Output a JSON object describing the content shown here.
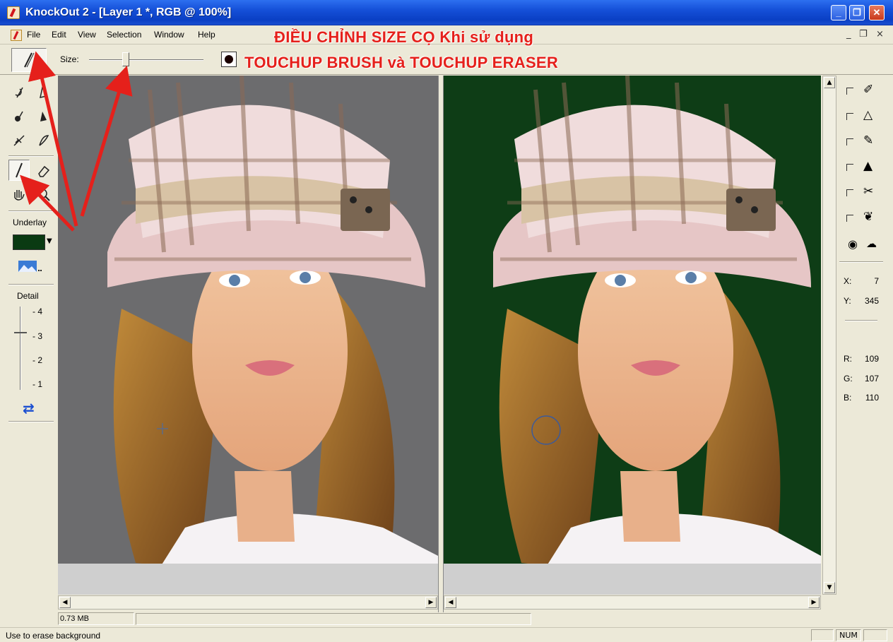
{
  "window": {
    "title": "KnockOut 2 - [Layer 1 *, RGB @ 100%]",
    "controls": {
      "minimize": "_",
      "restore": "❐",
      "close": "✕"
    }
  },
  "menu": {
    "items": [
      "File",
      "Edit",
      "View",
      "Selection",
      "Window",
      "Help"
    ],
    "mdi_controls": {
      "minimize": "_",
      "restore": "❐",
      "close": "×"
    }
  },
  "annotation": {
    "line1": "ĐIỀU CHỈNH SIZE CỌ Khi sử dụng",
    "line2": "TOUCHUP BRUSH và TOUCHUP ERASER",
    "color": "#e5201b"
  },
  "tool_options": {
    "size_label": "Size:",
    "size_value_fraction": 0.32,
    "current_tool_icon": "touchup-brush-icon"
  },
  "left_toolbar": {
    "tools": [
      [
        "inside-object-icon",
        "outside-object-icon"
      ],
      [
        "inside-object-fill-icon",
        "outside-object-fill-icon"
      ],
      [
        "shadow-icon",
        "fine-detail-icon"
      ],
      [
        "touchup-brush-icon",
        "touchup-eraser-icon"
      ],
      [
        "hand-icon",
        "zoom-icon"
      ]
    ],
    "underlay_label": "Underlay",
    "underlay_color": "#0a3a12",
    "detail_label": "Detail",
    "detail_ticks": [
      "- 4",
      "- 3",
      "- 2",
      "- 1"
    ],
    "detail_value": 3
  },
  "right_panel": {
    "layers": [
      "inside-object-icon",
      "outside-object-icon",
      "inside-object-fill-icon",
      "outside-object-fill-icon",
      "shadow-icon",
      "fine-detail-icon"
    ],
    "coords": {
      "x_label": "X:",
      "x": "7",
      "y_label": "Y:",
      "y": "345"
    },
    "rgb": {
      "r_label": "R:",
      "r": "109",
      "g_label": "G:",
      "g": "107",
      "b_label": "B:",
      "b": "110"
    }
  },
  "status": {
    "memory": "0.73 MB",
    "message": "Use to erase background",
    "num": "NUM"
  },
  "colors": {
    "left_background": "#6c6c6e",
    "right_background": "#0e3d16"
  }
}
